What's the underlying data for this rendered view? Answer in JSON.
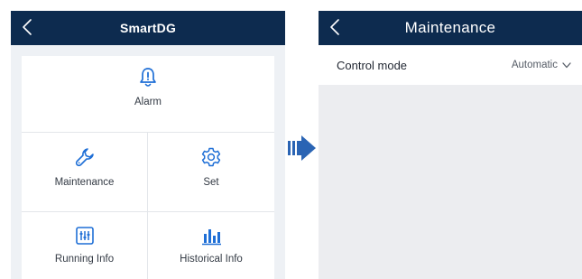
{
  "left_screen": {
    "title": "SmartDG",
    "tiles": {
      "alarm": "Alarm",
      "maintenance": "Maintenance",
      "set": "Set",
      "running_info": "Running Info",
      "historical_info": "Historical Info"
    }
  },
  "right_screen": {
    "title": "Maintenance",
    "control_mode": {
      "label": "Control mode",
      "value": "Automatic"
    }
  },
  "colors": {
    "header_bg": "#0d2b4f",
    "icon_accent": "#1f6fd6",
    "arrow": "#2a64b4",
    "panel_bg": "#eef1f5"
  },
  "icons": {
    "back": "chevron-left-icon",
    "alarm": "bell-icon",
    "maintenance": "wrench-icon",
    "set": "gear-icon",
    "running_info": "sliders-icon",
    "historical_info": "bar-chart-icon",
    "dropdown": "chevron-down-icon",
    "transition": "right-arrow-icon"
  }
}
